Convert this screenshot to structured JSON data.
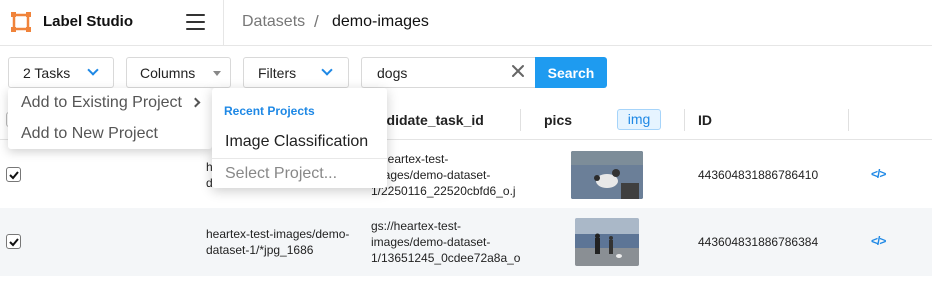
{
  "header": {
    "app_name": "Label Studio",
    "breadcrumbs": [
      "Datasets",
      "demo-images"
    ],
    "breadcrumb_separator": "/"
  },
  "toolbar": {
    "tasks_label": "2 Tasks",
    "columns_label": "Columns",
    "filters_label": "Filters",
    "search_value": "dogs",
    "search_button": "Search"
  },
  "tasks_menu": {
    "items": [
      "Add to Existing Project",
      "Add to New Project"
    ]
  },
  "projects_submenu": {
    "header": "Recent Projects",
    "projects": [
      "Image Classification"
    ],
    "select_label": "Select Project..."
  },
  "table": {
    "columns": [
      "ndidate_task_id",
      "pics",
      "ID"
    ],
    "pics_type_badge": "img",
    "rows": [
      {
        "checked": true,
        "source_partial": [
          "h",
          "d"
        ],
        "candidate_task_id": [
          "://heartex-test-",
          "images/demo-dataset-",
          "1/2250116_22520cbfd6_o.j"
        ],
        "id": "443604831886786410"
      },
      {
        "checked": true,
        "source": [
          "heartex-test-images/demo-",
          "dataset-1/*jpg_1686"
        ],
        "candidate_task_id": [
          "gs://heartex-test-",
          "images/demo-dataset-",
          "1/13651245_0cdee72a8a_o"
        ],
        "id": "443604831886786384"
      }
    ]
  },
  "colors": {
    "accent": "#1e9bf0",
    "logo": "#f0833a",
    "row_alt": "#f4f6f8"
  }
}
